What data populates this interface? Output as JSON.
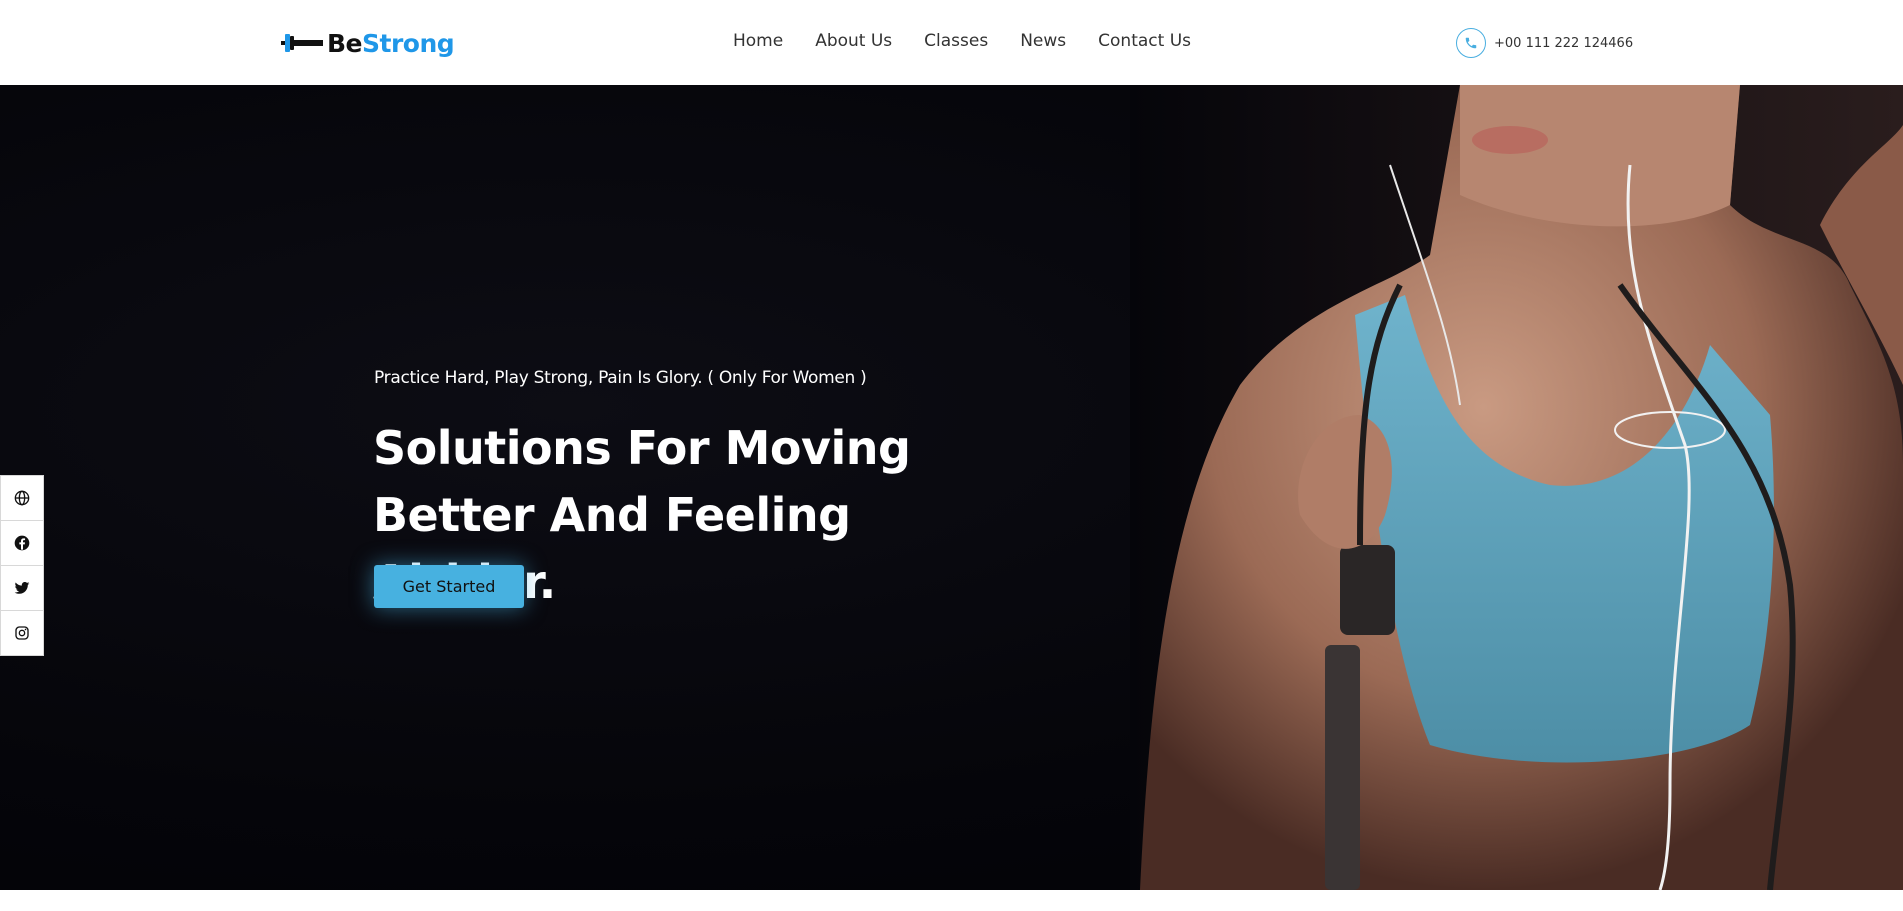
{
  "brand": {
    "name_part1": "Be",
    "name_part2": "Strong",
    "accent_color": "#1f97e8"
  },
  "nav": {
    "items": [
      {
        "label": "Home"
      },
      {
        "label": "About Us"
      },
      {
        "label": "Classes"
      },
      {
        "label": "News"
      },
      {
        "label": "Contact Us"
      }
    ]
  },
  "contact": {
    "phone": "+00 111 222 124466",
    "icon": "phone-icon"
  },
  "hero": {
    "tagline": "Practice Hard, Play Strong, Pain Is Glory. ( Only For Women )",
    "title_line1": "Solutions For Moving",
    "title_line2": "Better And Feeling Althier.",
    "cta_label": "Get Started",
    "cta_color": "#47b1e0",
    "image_description_icon": "athlete-photo"
  },
  "social": {
    "items": [
      {
        "icon": "globe-icon"
      },
      {
        "icon": "facebook-icon"
      },
      {
        "icon": "twitter-icon"
      },
      {
        "icon": "instagram-icon"
      }
    ]
  }
}
